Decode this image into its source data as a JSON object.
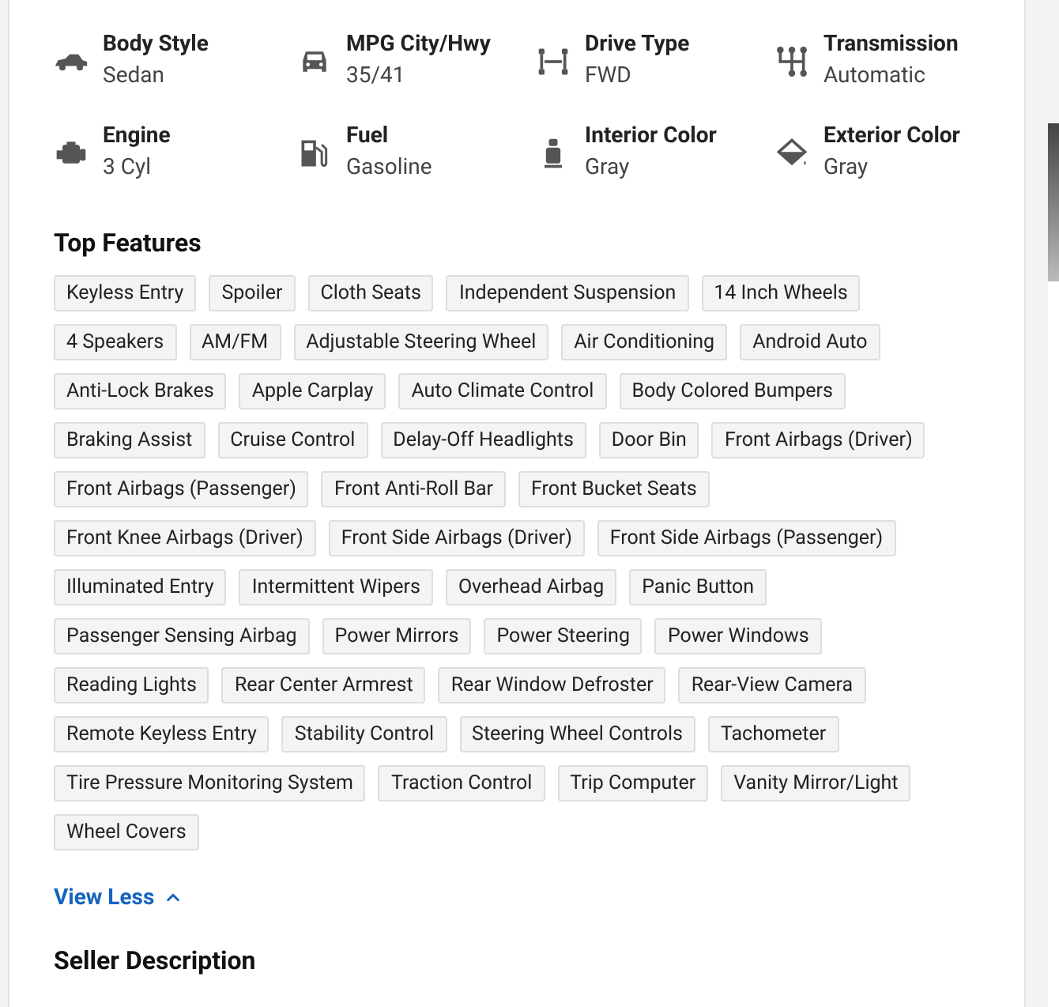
{
  "specs": [
    {
      "label": "Body Style",
      "value": "Sedan"
    },
    {
      "label": "MPG City/Hwy",
      "value": "35/41"
    },
    {
      "label": "Drive Type",
      "value": "FWD"
    },
    {
      "label": "Transmission",
      "value": "Automatic"
    },
    {
      "label": "Engine",
      "value": "3 Cyl"
    },
    {
      "label": "Fuel",
      "value": "Gasoline"
    },
    {
      "label": "Interior Color",
      "value": "Gray"
    },
    {
      "label": "Exterior Color",
      "value": "Gray"
    }
  ],
  "top_features": {
    "title": "Top Features",
    "features": [
      "Keyless Entry",
      "Spoiler",
      "Cloth Seats",
      "Independent Suspension",
      "14 Inch Wheels",
      "4 Speakers",
      "AM/FM",
      "Adjustable Steering Wheel",
      "Air Conditioning",
      "Android Auto",
      "Anti-Lock Brakes",
      "Apple Carplay",
      "Auto Climate Control",
      "Body Colored Bumpers",
      "Braking Assist",
      "Cruise Control",
      "Delay-Off Headlights",
      "Door Bin",
      "Front Airbags (Driver)",
      "Front Airbags (Passenger)",
      "Front Anti-Roll Bar",
      "Front Bucket Seats",
      "Front Knee Airbags (Driver)",
      "Front Side Airbags (Driver)",
      "Front Side Airbags (Passenger)",
      "Illuminated Entry",
      "Intermittent Wipers",
      "Overhead Airbag",
      "Panic Button",
      "Passenger Sensing Airbag",
      "Power Mirrors",
      "Power Steering",
      "Power Windows",
      "Reading Lights",
      "Rear Center Armrest",
      "Rear Window Defroster",
      "Rear-View Camera",
      "Remote Keyless Entry",
      "Stability Control",
      "Steering Wheel Controls",
      "Tachometer",
      "Tire Pressure Monitoring System",
      "Traction Control",
      "Trip Computer",
      "Vanity Mirror/Light",
      "Wheel Covers"
    ],
    "toggle": {
      "label": "View Less",
      "expanded": true
    }
  },
  "next_section": {
    "title": "Seller Description"
  }
}
